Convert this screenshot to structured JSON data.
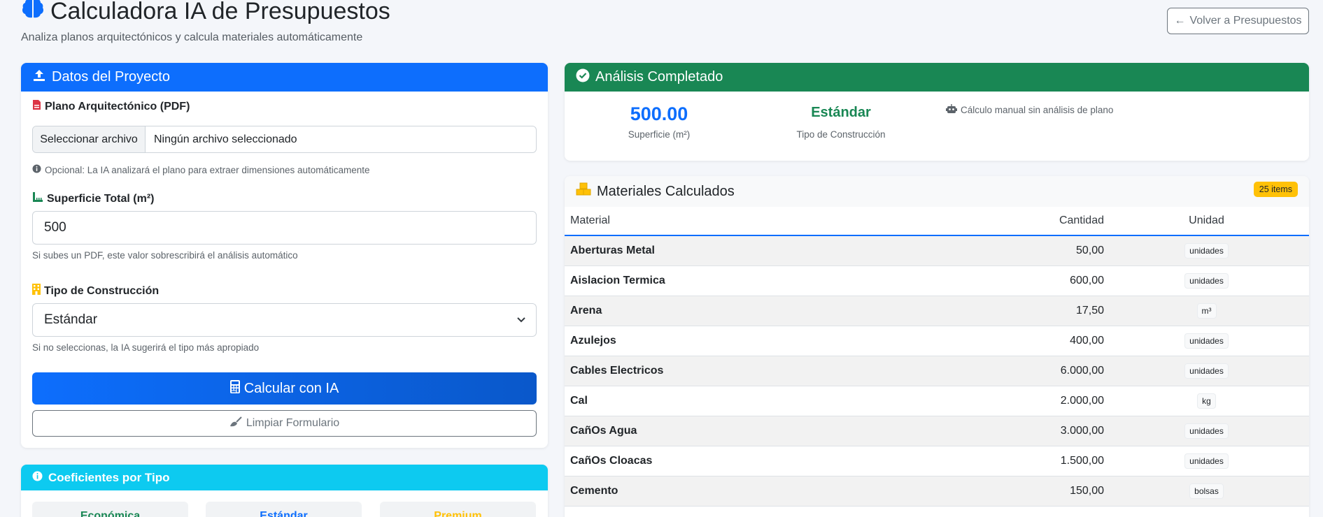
{
  "header": {
    "title": "Calculadora IA de Presupuestos",
    "subtitle": "Analiza planos arquitectónicos y calcula materiales automáticamente",
    "back_label": "Volver a Presupuestos"
  },
  "form": {
    "card_title": "Datos del Proyecto",
    "plano_label": "Plano Arquitectónico (PDF)",
    "file_button": "Seleccionar archivo",
    "file_status": "Ningún archivo seleccionado",
    "plano_help": "Opcional: La IA analizará el plano para extraer dimensiones automáticamente",
    "superficie_label": "Superficie Total (m²)",
    "superficie_value": "500",
    "superficie_help": "Si subes un PDF, este valor sobrescribirá el análisis automático",
    "tipo_label": "Tipo de Construcción",
    "tipo_value": "Estándar",
    "tipo_help": "Si no seleccionas, la IA sugerirá el tipo más apropiado",
    "calc_button": "Calcular con IA",
    "clear_button": "Limpiar Formulario"
  },
  "coeficientes": {
    "title": "Coeficientes por Tipo",
    "types": [
      "Económica",
      "Estándar",
      "Premium"
    ],
    "colors": [
      "#198754",
      "#0d6efd",
      "#ffc107"
    ]
  },
  "analysis": {
    "title": "Análisis Completado",
    "superficie_value": "500.00",
    "superficie_label": "Superficie (m²)",
    "tipo_value": "Estándar",
    "tipo_label": "Tipo de Construcción",
    "note": "Cálculo manual sin análisis de plano"
  },
  "materials": {
    "title": "Materiales Calculados",
    "badge": "25 items",
    "columns": [
      "Material",
      "Cantidad",
      "Unidad"
    ],
    "rows": [
      {
        "material": "Aberturas Metal",
        "cantidad": "50,00",
        "unidad": "unidades"
      },
      {
        "material": "Aislacion Termica",
        "cantidad": "600,00",
        "unidad": "unidades"
      },
      {
        "material": "Arena",
        "cantidad": "17,50",
        "unidad": "m³"
      },
      {
        "material": "Azulejos",
        "cantidad": "400,00",
        "unidad": "unidades"
      },
      {
        "material": "Cables Electricos",
        "cantidad": "6.000,00",
        "unidad": "unidades"
      },
      {
        "material": "Cal",
        "cantidad": "2.000,00",
        "unidad": "kg"
      },
      {
        "material": "CañOs Agua",
        "cantidad": "3.000,00",
        "unidad": "unidades"
      },
      {
        "material": "CañOs Cloacas",
        "cantidad": "1.500,00",
        "unidad": "unidades"
      },
      {
        "material": "Cemento",
        "cantidad": "150,00",
        "unidad": "bolsas"
      },
      {
        "material": "",
        "cantidad": "",
        "unidad": ""
      }
    ]
  }
}
